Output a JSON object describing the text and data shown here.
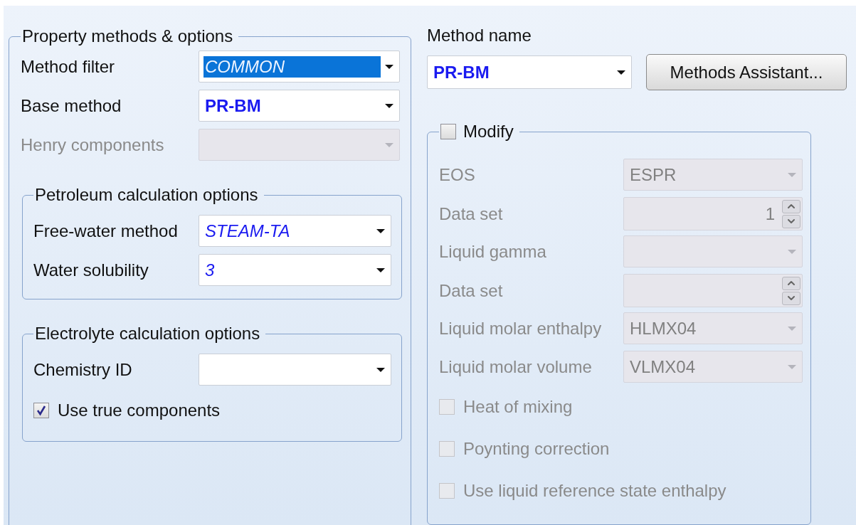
{
  "property_methods": {
    "title": "Property methods & options",
    "rows": [
      {
        "kind": "dropdown",
        "label": "Method filter",
        "value": "COMMON",
        "bold": false,
        "italic": true,
        "highlighted": true,
        "disabled": false
      },
      {
        "kind": "dropdown",
        "label": "Base method",
        "value": "PR-BM",
        "bold": true,
        "italic": false,
        "disabled": false
      },
      {
        "kind": "dropdown",
        "label": "Henry components",
        "disabled": true
      },
      {
        "kind": "group",
        "title": "Petroleum calculation options",
        "rows": [
          {
            "kind": "dropdown",
            "label": "Free-water method",
            "value": "STEAM-TA",
            "bold": false,
            "italic": true,
            "disabled": false
          },
          {
            "kind": "dropdown",
            "label": "Water solubility",
            "value": "3",
            "bold": false,
            "italic": true,
            "disabled": false
          }
        ]
      },
      {
        "kind": "group",
        "title": "Electrolyte calculation options",
        "rows": [
          {
            "kind": "dropdown",
            "label": "Chemistry ID",
            "disabled": false
          },
          {
            "kind": "checkbox",
            "label": "Use true components",
            "checked": true,
            "disabled": false
          }
        ]
      }
    ]
  },
  "method_name": {
    "label": "Method name",
    "value": "PR-BM",
    "bold": true,
    "button": "Methods Assistant..."
  },
  "modify": {
    "label": "Modify",
    "checked": false,
    "rows": [
      {
        "kind": "dropdown",
        "label": "EOS",
        "value": "ESPR",
        "disabled": true
      },
      {
        "kind": "spin",
        "label": "Data set",
        "value": "1",
        "disabled": true
      },
      {
        "kind": "dropdown",
        "label": "Liquid gamma",
        "disabled": true
      },
      {
        "kind": "spin",
        "label": "Data set",
        "disabled": true
      },
      {
        "kind": "dropdown",
        "label": "Liquid molar enthalpy",
        "value": "HLMX04",
        "disabled": true
      },
      {
        "kind": "dropdown",
        "label": "Liquid molar volume",
        "value": "VLMX04",
        "disabled": true
      },
      {
        "kind": "checkbox",
        "label": "Heat of mixing",
        "checked": false,
        "disabled": true
      },
      {
        "kind": "checkbox",
        "label": "Poynting correction",
        "checked": false,
        "disabled": true
      },
      {
        "kind": "checkbox",
        "label": "Use liquid reference state enthalpy",
        "checked": false,
        "disabled": true
      }
    ]
  }
}
